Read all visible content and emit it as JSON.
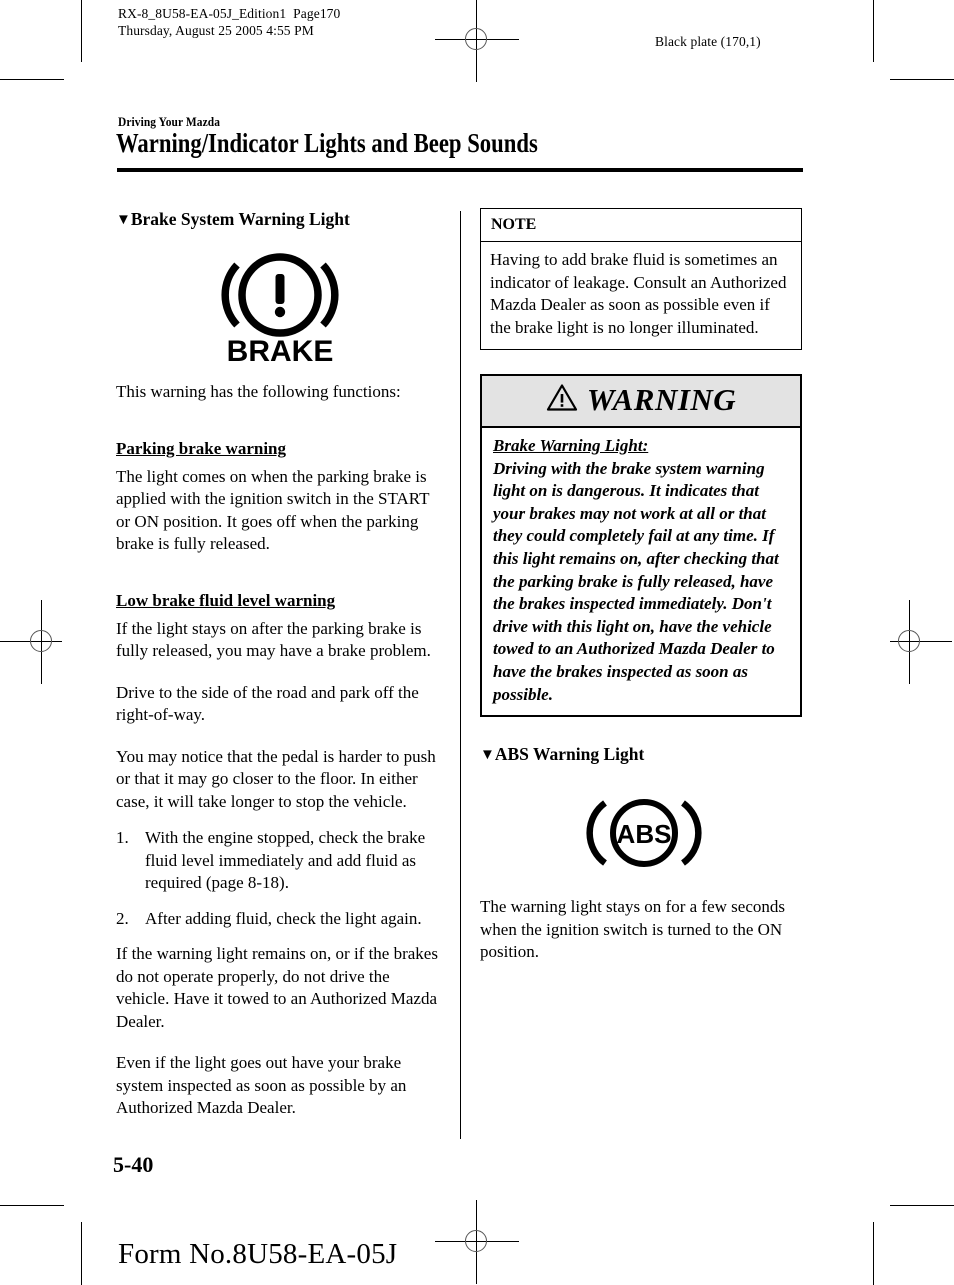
{
  "print_marks": {
    "header_left_line1": "RX-8_8U58-EA-05J_Edition1  Page170",
    "header_left_line2": "Thursday, August 25 2005 4:55 PM",
    "header_right": "Black plate (170,1)"
  },
  "section": {
    "chapter_label": "Driving Your Mazda",
    "title": "Warning/Indicator Lights and Beep Sounds"
  },
  "left_column": {
    "heading_marker": "▼",
    "heading": "Brake System Warning Light",
    "icon": {
      "name": "brake-warning-light-icon",
      "label": "BRAKE",
      "symbol": "!"
    },
    "intro": "This warning has the following functions:",
    "sub1_title": "Parking brake warning",
    "sub1_body": "The light comes on when the parking brake is applied with the ignition switch in the START or ON position. It goes off when the parking brake is fully released.",
    "sub2_title": "Low brake fluid level warning",
    "sub2_p1": "If the light stays on after the parking brake is fully released, you may have a brake problem.",
    "sub2_p2": "Drive to the side of the road and park off the right-of-way.",
    "sub2_p3": "You may notice that the pedal is harder to push or that it may go closer to the floor. In either case, it will take longer to stop the vehicle.",
    "steps": [
      {
        "num": "1.",
        "text": "With the engine stopped, check the brake fluid level immediately and add fluid as required (page 8-18)."
      },
      {
        "num": "2.",
        "text": "After adding fluid, check the light again."
      }
    ],
    "after_steps_p1": "If the warning light remains on, or if the brakes do not operate properly, do not drive the vehicle. Have it towed to an Authorized Mazda Dealer.",
    "after_steps_p2": "Even if the light goes out have your brake system inspected as soon as possible by an Authorized Mazda Dealer."
  },
  "right_column": {
    "note": {
      "title": "NOTE",
      "body": "Having to add brake fluid is sometimes an indicator of leakage. Consult an Authorized Mazda Dealer as soon as possible even if the brake light is no longer illuminated."
    },
    "warning": {
      "title": "WARNING",
      "icon_name": "warning-triangle-icon",
      "subject": "Brake Warning Light:",
      "body": "Driving with the brake system warning light on is dangerous. It indicates that your brakes may not work at all or that they could completely fail at any time. If this light remains on, after checking that the parking brake is fully released, have the brakes inspected immediately. Don't drive with this light on, have the vehicle towed to an Authorized Mazda Dealer to have the brakes inspected as soon as possible."
    },
    "abs": {
      "heading_marker": "▼",
      "heading": "ABS Warning Light",
      "icon": {
        "name": "abs-warning-light-icon",
        "label": "ABS"
      },
      "body": "The warning light stays on for a few seconds when the ignition switch is turned to the ON position."
    }
  },
  "footer": {
    "page_number": "5-40",
    "form_number": "Form No.8U58-EA-05J"
  },
  "colors": {
    "ink": "#000000",
    "paper": "#ffffff",
    "warning_header_bg": "#e3e3e3"
  }
}
